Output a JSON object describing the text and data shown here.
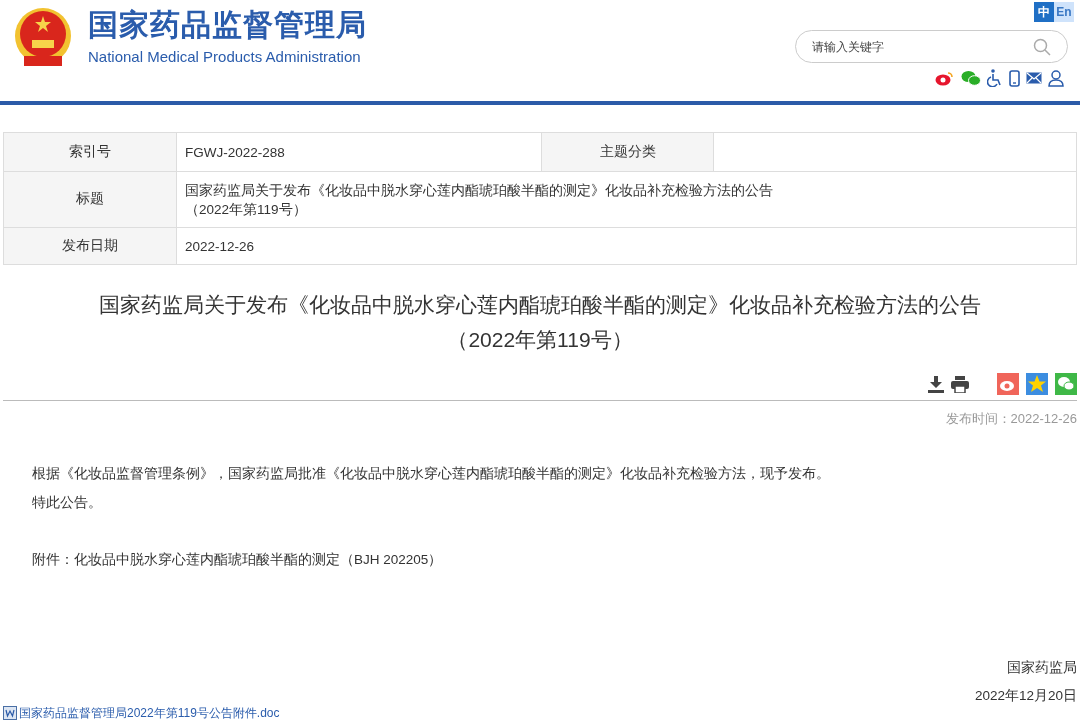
{
  "header": {
    "title": "国家药品监督管理局",
    "subtitle": "National Medical Products Administration",
    "languages": [
      {
        "label": "中",
        "selected": true
      },
      {
        "label": "En",
        "selected": false
      }
    ],
    "search": {
      "placeholder": "请输入关键字"
    }
  },
  "meta": {
    "rows": [
      [
        {
          "label": "索引号",
          "value": "FGWJ-2022-288"
        },
        {
          "label": "主题分类"
        }
      ],
      [
        {
          "label": "标题",
          "value": "国家药监局关于发布《化妆品中脱水穿心莲内酯琥珀酸半酯的测定》化妆品补充检验方法的公告（2022年第119号）"
        }
      ],
      [
        {
          "label": "发布日期",
          "value": "2022-12-26"
        }
      ]
    ]
  },
  "article": {
    "title_lines": [
      "国家药监局关于发布《化妆品中脱水穿心莲内酯琥珀酸半酯的测定》化妆品补充检验方法的公告",
      "（2022年第119号）"
    ],
    "publish_time": "发布时间：2022-12-26",
    "paragraphs": [
      "根据《化妆品监督管理条例》，国家药监局批准《化妆品中脱水穿心莲内酯琥珀酸半酯的测定》化妆品补充检验方法，现予发布。",
      "特此公告。"
    ],
    "attachment_note": "附件：化妆品中脱水穿心莲内酯琥珀酸半酯的测定（BJH 202205）",
    "signature": "国家药监局",
    "date": "2022年12月20日",
    "attachment_link": "国家药品监督管理局2022年第119号公告附件.doc"
  }
}
